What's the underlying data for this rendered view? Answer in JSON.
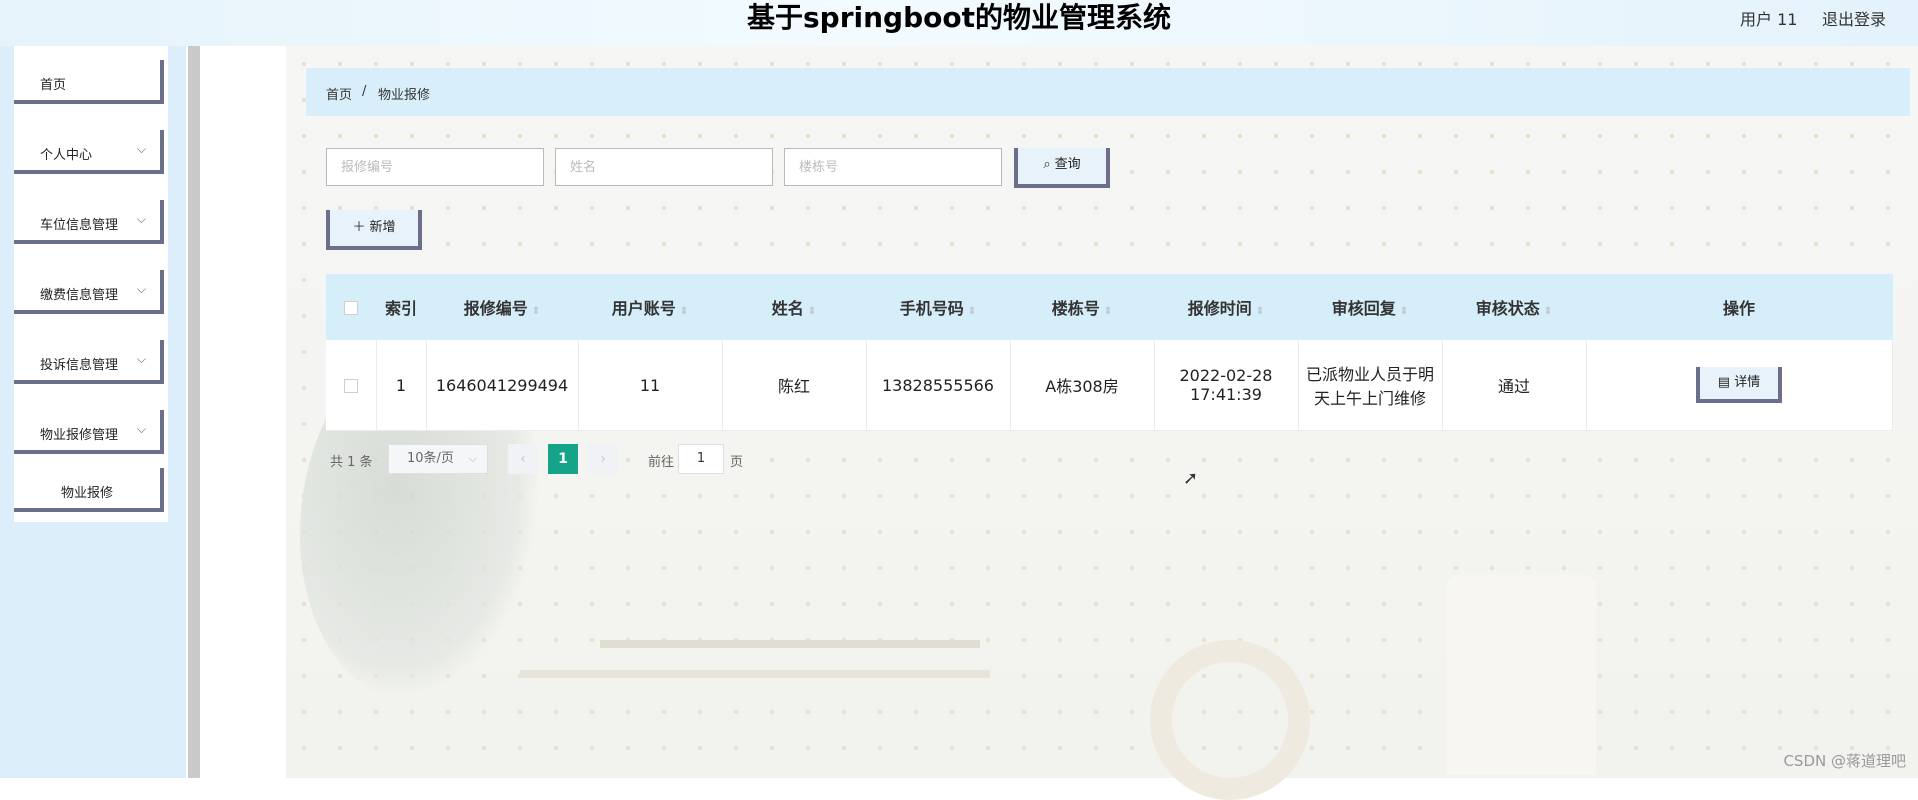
{
  "header": {
    "title": "基于springboot的物业管理系统",
    "user": "用户 11",
    "logout": "退出登录"
  },
  "sidebar": {
    "items": [
      {
        "label": "首页"
      },
      {
        "label": "个人中心"
      },
      {
        "label": "车位信息管理"
      },
      {
        "label": "缴费信息管理"
      },
      {
        "label": "投诉信息管理"
      },
      {
        "label": "物业报修管理"
      },
      {
        "label": "物业报修"
      }
    ]
  },
  "breadcrumb": {
    "home": "首页",
    "sep": "/",
    "current": "物业报修"
  },
  "search": {
    "repair_no_placeholder": "报修编号",
    "name_placeholder": "姓名",
    "building_placeholder": "楼栋号",
    "query_label": "查询"
  },
  "actions": {
    "add_label": "新增"
  },
  "table": {
    "columns": [
      "索引",
      "报修编号",
      "用户账号",
      "姓名",
      "手机号码",
      "楼栋号",
      "报修时间",
      "审核回复",
      "审核状态",
      "操作"
    ],
    "rows": [
      {
        "index": "1",
        "repair_no": "1646041299494",
        "account": "11",
        "name": "陈红",
        "phone": "13828555566",
        "building": "A栋308房",
        "time": "2022-02-28 17:41:39",
        "reply": "已派物业人员于明天上午上门维修",
        "status": "通过",
        "action": "详情"
      }
    ]
  },
  "pagination": {
    "total": "共 1 条",
    "page_size": "10条/页",
    "current": "1",
    "goto_label": "前往",
    "goto_value": "1",
    "page_unit": "页"
  },
  "watermark": "CSDN @蒋道理吧",
  "colors": {
    "menu_border": "#6b6f8a",
    "header_bg": "#d6eefa",
    "pager_active": "#15a38a"
  }
}
